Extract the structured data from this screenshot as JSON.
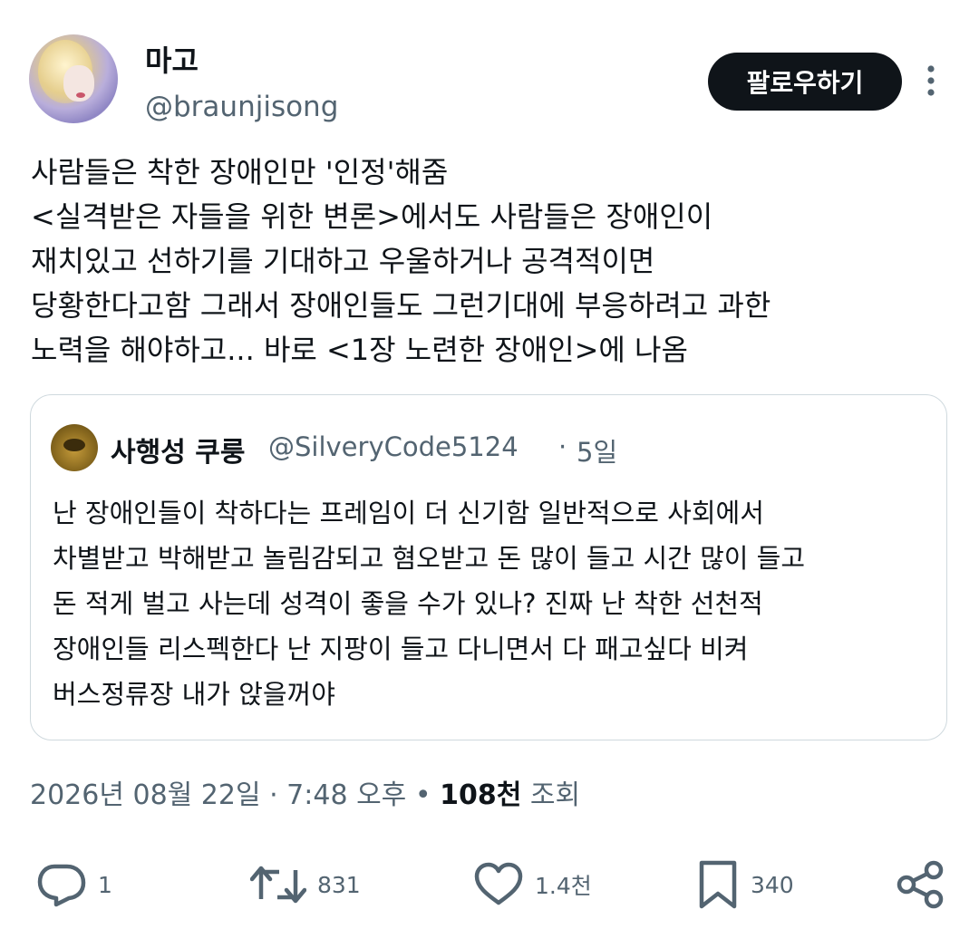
{
  "author": {
    "display_name": "마고",
    "handle": "@braunjisong",
    "follow_label": "팔로우하기"
  },
  "tweet": {
    "text": "사람들은 착한 장애인만 '인정'해줌\n<실격받은 자들을 위한 변론>에서도 사람들은 장애인이\n재치있고 선하기를 기대하고 우울하거나 공격적이면\n당황한다고함 그래서 장애인들도 그런기대에 부응하려고 과한\n노력을 해야하고... 바로 <1장 노련한 장애인>에 나옴"
  },
  "quote": {
    "display_name": "사행성 쿠룽",
    "handle": "@SilveryCode5124",
    "separator": "·",
    "time": "5일",
    "text": "난 장애인들이 착하다는 프레임이 더 신기함 일반적으로 사회에서\n차별받고 박해받고 놀림감되고 혐오받고 돈 많이 들고 시간 많이 들고\n돈 적게 벌고 사는데 성격이 좋을 수가 있나? 진짜 난 착한 선천적\n장애인들 리스펙한다 난 지팡이 들고 다니면서 다 패고싶다 비켜\n버스정류장 내가 앉을꺼야"
  },
  "meta": {
    "timestamp": "2026년 08월 22일 · 7:48 오후",
    "bullet": "•",
    "views_count": "108천",
    "views_label": "조회"
  },
  "actions": {
    "reply_count": "1",
    "retweet_count": "831",
    "like_count": "1.4천",
    "bookmark_count": "340"
  },
  "icons": {
    "reply": "reply-icon",
    "retweet": "retweet-icon",
    "like": "heart-icon",
    "bookmark": "bookmark-icon",
    "share": "share-icon",
    "more": "more-vertical-icon"
  },
  "colors": {
    "text": "#0f1419",
    "secondary": "#536471",
    "border": "#cfd9de",
    "button_bg": "#0f1419"
  }
}
